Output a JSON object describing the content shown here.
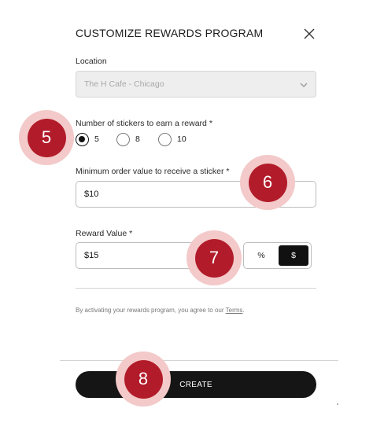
{
  "modal": {
    "title": "CUSTOMIZE REWARDS PROGRAM",
    "close_icon": "close-icon"
  },
  "location": {
    "label": "Location",
    "value": "The H Cafe - Chicago",
    "icon": "chevron-down-icon"
  },
  "stickers": {
    "label": "Number of stickers to earn a reward *",
    "options": [
      {
        "label": "5",
        "checked": true
      },
      {
        "label": "8",
        "checked": false
      },
      {
        "label": "10",
        "checked": false
      }
    ]
  },
  "min_order": {
    "label": "Minimum order value to receive a sticker *",
    "value": "$10"
  },
  "reward_value": {
    "label": "Reward Value *",
    "value": "$15",
    "unit_options": [
      "%",
      "$"
    ],
    "selected_unit": "$"
  },
  "terms": {
    "prefix": "By activating your rewards program, you agree to our ",
    "link": "Terms",
    "suffix": "."
  },
  "create_button": "CREATE",
  "callouts": [
    "5",
    "6",
    "7",
    "8"
  ],
  "colors": {
    "callout_fill": "#b21c2a",
    "callout_halo": "#f3c9c9",
    "primary_button": "#151515"
  }
}
